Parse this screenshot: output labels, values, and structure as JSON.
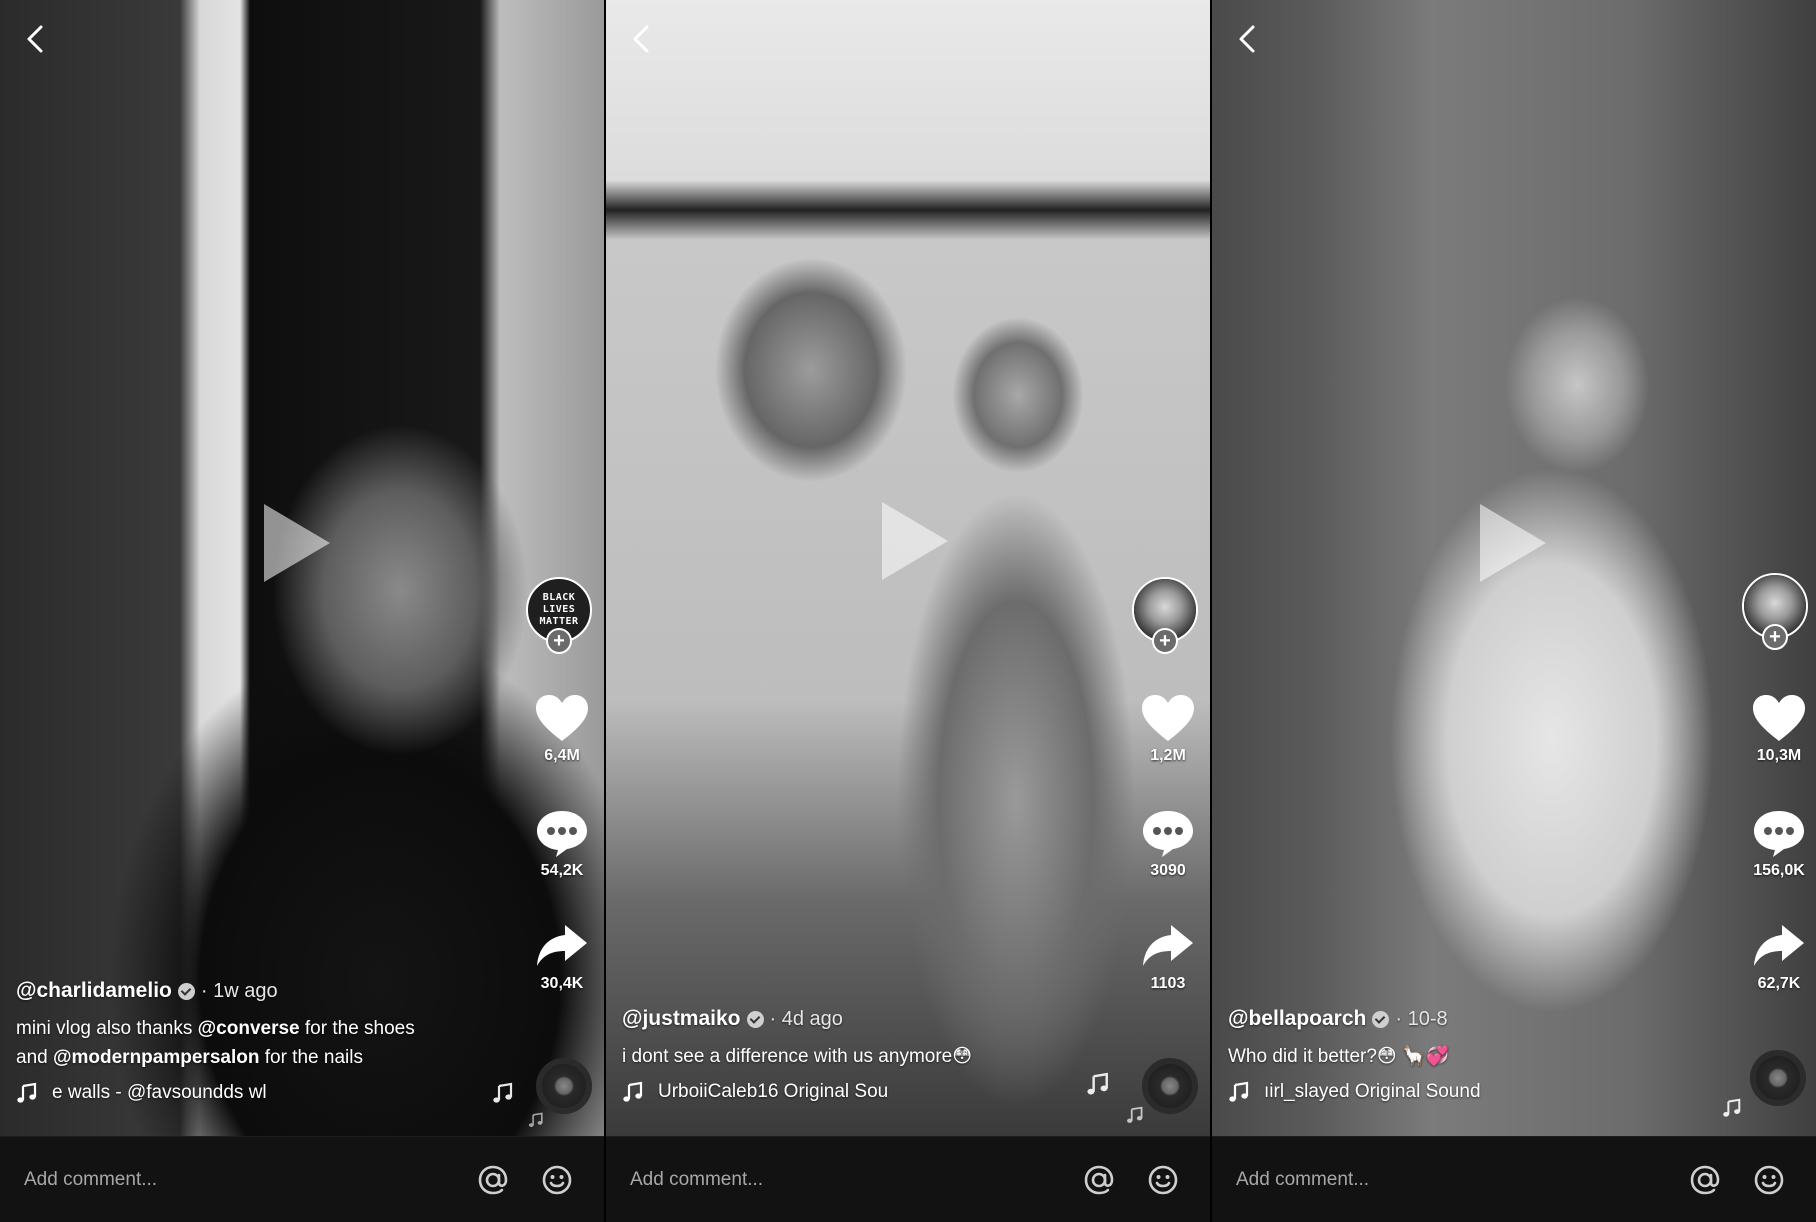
{
  "comment_placeholder": "Add comment...",
  "panels": [
    {
      "username": "@charlidamelio",
      "age": "· 1w ago",
      "desc_part1": "mini vlog also thanks ",
      "mention1": "@converse",
      "desc_part2": " for the shoes",
      "desc_part3": "and ",
      "mention2": "@modernpampersalon",
      "desc_part4": " for the nails",
      "sound": "e walls - @favsoundds     wl",
      "avatar_text": "BLACK LIVES MATTER",
      "likes": "6,4M",
      "comments": "54,2K",
      "shares": "30,4K"
    },
    {
      "username": "@justmaiko",
      "age": "· 4d ago",
      "desc": "i dont see a difference with us anymore😳",
      "sound": "UrboiiCaleb16 Original Sou",
      "likes": "1,2M",
      "comments": "3090",
      "shares": "1103"
    },
    {
      "username": "@bellapoarch",
      "age": "· 10-8",
      "desc": "Who did it better?😳 🦙💞",
      "sound": "ıirl_slayed Original Sound",
      "likes": "10,3M",
      "comments": "156,0K",
      "shares": "62,7K"
    }
  ],
  "icons": {
    "back": "chevron-left-icon",
    "like": "heart-icon",
    "comment": "speech-bubble-icon",
    "share": "share-arrow-icon",
    "sound": "music-note-icon",
    "mention": "at-sign-icon",
    "emoji": "smiley-icon"
  }
}
